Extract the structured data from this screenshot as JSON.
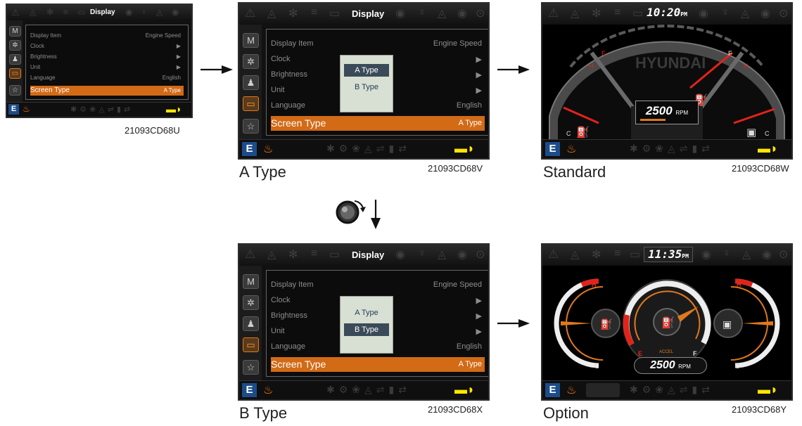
{
  "screens": {
    "display_title": "Display",
    "menu": [
      {
        "label": "Display Item",
        "value": "Engine Speed"
      },
      {
        "label": "Clock",
        "value": "▶"
      },
      {
        "label": "Brightness",
        "value": "▶"
      },
      {
        "label": "Unit",
        "value": "▶"
      },
      {
        "label": "Language",
        "value": "English"
      },
      {
        "label": "Screen Type",
        "value": "A Type"
      }
    ],
    "popup_options": [
      "A Type",
      "B Type"
    ],
    "sidebar_letter": "M",
    "e_button": "E"
  },
  "figures": {
    "small": {
      "code": "21093CD68U"
    },
    "a_type": {
      "caption": "A Type",
      "code": "21093CD68V",
      "selected_option": "A Type"
    },
    "b_type": {
      "caption": "B Type",
      "code": "21093CD68X",
      "selected_option": "B Type"
    },
    "standard": {
      "caption": "Standard",
      "code": "21093CD68W",
      "clock": "10:20",
      "ampm": "PM",
      "rpm": "2500",
      "rpm_unit": "RPM",
      "brand": "HYUNDAI",
      "hot": "H",
      "cold": "C",
      "full": "F",
      "empty": "E"
    },
    "option": {
      "caption": "Option",
      "code": "21093CD68Y",
      "clock": "11:35",
      "ampm": "PM",
      "rpm": "2500",
      "rpm_unit": "RPM",
      "accel": "ACCEL",
      "hot": "H",
      "cold": "C",
      "full": "F",
      "empty": "E"
    }
  },
  "icons": {
    "arrow": "right-arrow-icon",
    "knob": "rotary-knob-icon",
    "turtle": "turtle-icon",
    "gear": "gear-icon",
    "star": "star-icon"
  },
  "colors": {
    "highlight": "#d26a16",
    "popup": "#d7e0d2",
    "needle": "#e2231a",
    "accent": "#ff8a1e",
    "turtle": "#ffe600"
  }
}
